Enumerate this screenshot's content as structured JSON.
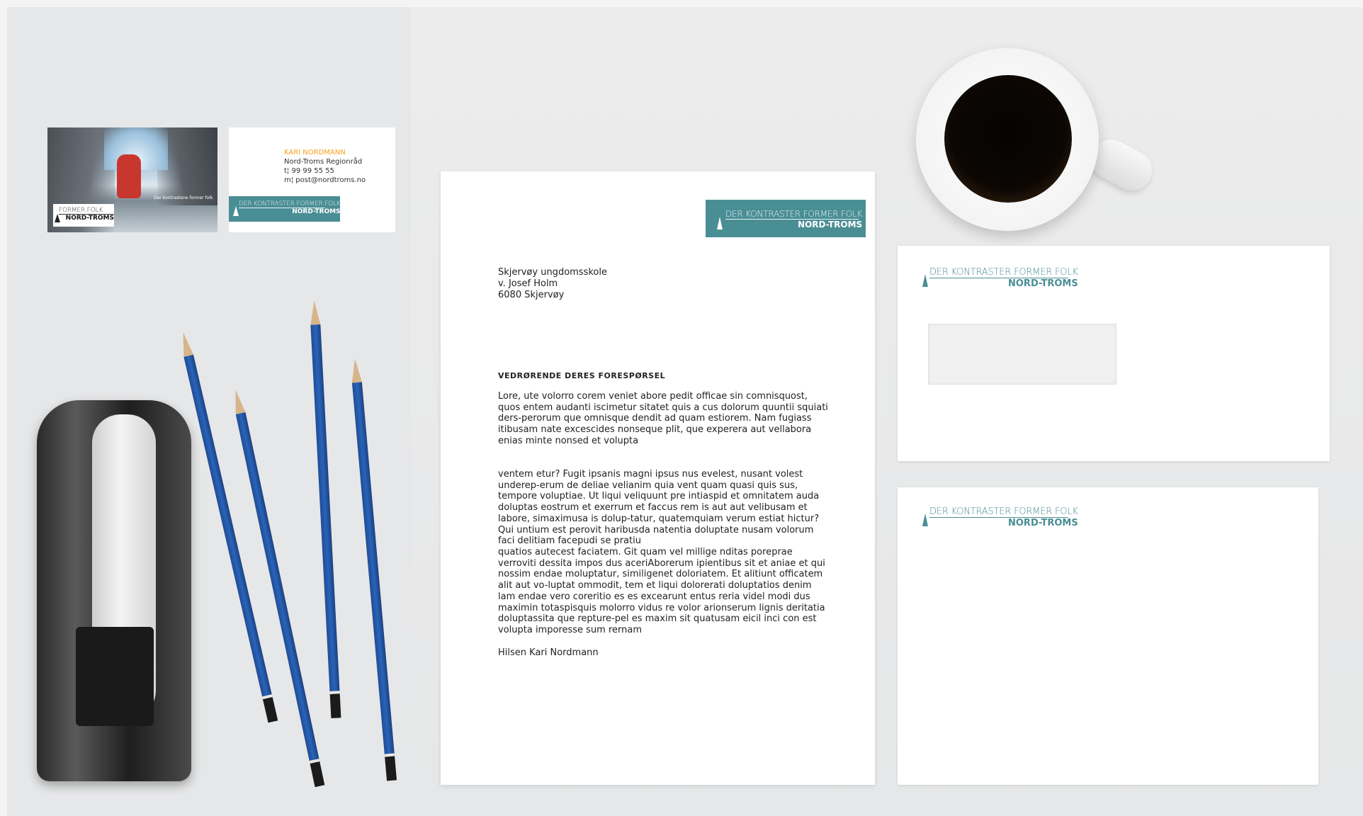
{
  "business_card": {
    "tagline": "Der kontrastene former folk",
    "name": "KARI NORDMANN",
    "org": "Nord-Troms Regionråd",
    "phone": "t¦ 99 99 55 55",
    "email": "m¦ post@nordtroms.no"
  },
  "logo": {
    "tagline": "DER KONTRASTER FORMER FOLK",
    "org": "NORD-TROMS",
    "card_tagline": "FORMER FOLK"
  },
  "letter": {
    "recipient_lines": [
      "Skjervøy ungdomsskole",
      "v. Josef Holm",
      "6080 Skjervøy"
    ],
    "heading": "VEDRØRENDE DERES FORESPØRSEL",
    "paragraphs": [
      "Lore, ute volorro corem veniet abore pedit officae sin comnisquost, quos entem audanti iscimetur sitatet quis a cus dolorum quuntii squiati ders-perorum que omnisque dendit ad quam estiorem. Nam fugiass itibusam nate excescides nonseque plit, que experera aut vellabora enias minte nonsed et volupta",
      "ventem etur? Fugit ipsanis magni ipsus nus evelest, nusant volest underep-erum de deliae velianim quia vent quam quasi quis sus, tempore voluptiae. Ut liqui veliquunt pre intiaspid et omnitatem auda doluptas eostrum et exerrum et faccus rem is aut aut velibusam et labore, simaximusa is dolup-tatur, quatemquiam verum estiat hictur? Qui untium est perovit haribusda natentia doluptate nusam volorum faci delitiam facepudi se pratiu",
      "quatios autecest faciatem. Git quam vel millige nditas poreprae verroviti dessita impos dus aceriAborerum ipientibus sit et aniae et qui nossim endae moluptatur, similigenet doloriatem. Et alitiunt officatem alit aut vo-luptat ommodit, tem et liqui dolorerati doluptatios denim lam endae vero coreritio es es excearunt entus reria videl modi dus maximin totaspisquis molorro vidus re volor arionserum lignis deritatia doluptassita que repture-pel es maxim sit quatusam eicil inci con est volupta imporesse sum rernam"
    ],
    "signoff": "Hilsen Kari Nordmann"
  },
  "colors": {
    "brand_teal": "#4a8e95",
    "accent_orange": "#f5a11b",
    "pencil_blue": "#2a63b8"
  }
}
